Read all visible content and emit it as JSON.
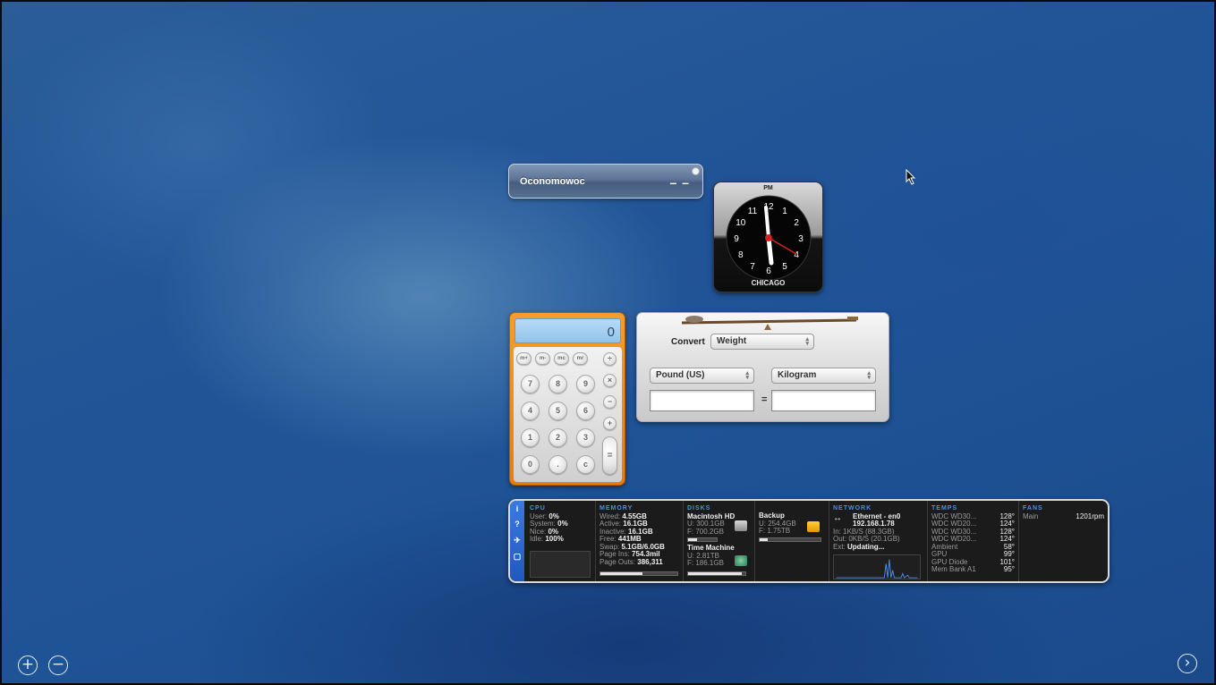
{
  "weather": {
    "city": "Oconomowoc",
    "temp": "– –"
  },
  "clock": {
    "ampm": "PM",
    "city": "CHICAGO",
    "numbers": [
      "12",
      "1",
      "2",
      "3",
      "4",
      "5",
      "6",
      "7",
      "8",
      "9",
      "10",
      "11"
    ]
  },
  "calculator": {
    "display": "0",
    "memory_keys": [
      "m+",
      "m-",
      "mc",
      "mr"
    ],
    "divide": "÷",
    "multiply": "×",
    "minus": "−",
    "plus": "+",
    "equals": "=",
    "rows": [
      [
        "7",
        "8",
        "9"
      ],
      [
        "4",
        "5",
        "6"
      ],
      [
        "1",
        "2",
        "3"
      ],
      [
        "0",
        ".",
        "c"
      ]
    ]
  },
  "converter": {
    "convert_label": "Convert",
    "category": "Weight",
    "from_unit": "Pound (US)",
    "to_unit": "Kilogram",
    "from_value": "",
    "to_value": "",
    "equals": "="
  },
  "istat": {
    "sidebar": [
      "i",
      "?",
      "✈",
      "▢"
    ],
    "cpu": {
      "header": "CPU",
      "rows": [
        {
          "label": "User:",
          "value": "0%"
        },
        {
          "label": "System:",
          "value": "0%"
        },
        {
          "label": "Nice:",
          "value": "0%"
        },
        {
          "label": "Idle:",
          "value": "100%"
        }
      ]
    },
    "memory": {
      "header": "MEMORY",
      "rows": [
        {
          "label": "Wired:",
          "value": "4.55GB"
        },
        {
          "label": "Active:",
          "value": "16.1GB"
        },
        {
          "label": "Inactive:",
          "value": "16.1GB"
        },
        {
          "label": "Free:",
          "value": "441MB"
        },
        {
          "label": "Swap:",
          "value": "5.1GB/6.0GB"
        },
        {
          "label": "Page Ins:",
          "value": "754.3mil"
        },
        {
          "label": "Page Outs:",
          "value": "386,311"
        }
      ],
      "usage": 0.55
    },
    "disks": {
      "header": "DISKS",
      "drives": [
        {
          "name": "Macintosh HD",
          "used": "U: 300.1GB",
          "free": "F: 700.2GB",
          "usage": 0.3
        },
        {
          "name": "Time Machine",
          "used": "U: 2.81TB",
          "free": "F: 186.1GB",
          "usage": 0.94
        }
      ],
      "backup": {
        "name": "Backup",
        "used": "U: 254.4GB",
        "free": "F: 1.75TB",
        "usage": 0.13
      }
    },
    "network": {
      "header": "NETWORK",
      "interface": "Ethernet - en0",
      "ip": "192.168.1.78",
      "in": "In: 1KB/S (88.3GB)",
      "out": "Out: 0KB/S (20.1GB)",
      "ext_label": "Ext:",
      "ext_value": "Updating..."
    },
    "temps": {
      "header": "TEMPS",
      "rows": [
        {
          "label": "WDC WD30...",
          "value": "128°"
        },
        {
          "label": "WDC WD20...",
          "value": "124°"
        },
        {
          "label": "WDC WD30...",
          "value": "128°"
        },
        {
          "label": "WDC WD20...",
          "value": "124°"
        },
        {
          "label": "Ambient",
          "value": "58°"
        },
        {
          "label": "GPU",
          "value": "99°"
        },
        {
          "label": "GPU Diode",
          "value": "101°"
        },
        {
          "label": "Mem Bank A1",
          "value": "95°"
        }
      ]
    },
    "fans": {
      "header": "FANS",
      "rows": [
        {
          "label": "Main",
          "value": "1201rpm"
        }
      ]
    }
  },
  "controls": {
    "add": "+",
    "remove": "−",
    "next": "›"
  },
  "colors": {
    "calculator": "#f0901e",
    "istat_accent": "#4a8ef0",
    "desktop": "#1f4f8e"
  }
}
